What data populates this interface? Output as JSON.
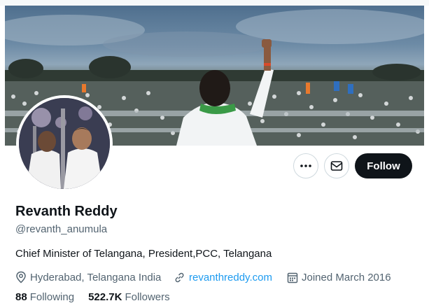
{
  "profile": {
    "name": "Revanth Reddy",
    "handle": "@revanth_anumula",
    "bio": "Chief Minister of Telangana, President,PCC, Telangana",
    "location": "Hyderabad, Telangana India",
    "website": "revanthreddy.com",
    "joined": "Joined March 2016"
  },
  "stats": {
    "following_count": "88",
    "following_label": "Following",
    "followers_count": "522.7K",
    "followers_label": "Followers"
  },
  "actions": {
    "follow_label": "Follow",
    "more_icon": "more-dots-icon",
    "message_icon": "envelope-icon"
  },
  "icons": {
    "location": "location-pin-icon",
    "link": "link-icon",
    "calendar": "calendar-icon"
  },
  "colors": {
    "primary_text": "#0f1419",
    "secondary_text": "#536471",
    "link": "#1d9bf0",
    "follow_button_bg": "#0f1419"
  }
}
